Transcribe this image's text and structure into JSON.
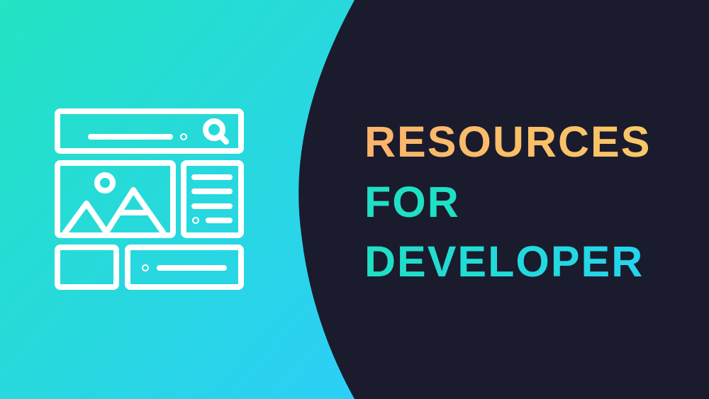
{
  "headline": {
    "line1": "RESOURCES",
    "line2": "FOR",
    "line3": "DEVELOPER"
  },
  "colors": {
    "background_dark": "#1b1b2e",
    "gradient_start": "#22e3c2",
    "gradient_end": "#2ccff7",
    "line1": "#fbb46c",
    "line2": "#1fe0c4",
    "line3": "#25d4ee"
  },
  "icon": "website-layout-icon"
}
